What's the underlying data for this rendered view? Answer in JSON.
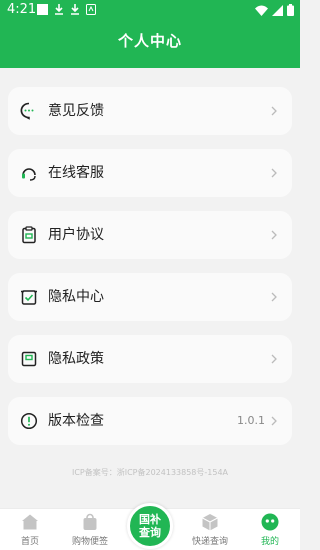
{
  "status_bar": {
    "time": "4:21"
  },
  "header": {
    "title": "个人中心"
  },
  "menu": [
    {
      "label": "意见反馈",
      "icon": "feedback-icon"
    },
    {
      "label": "在线客服",
      "icon": "headset-icon"
    },
    {
      "label": "用户协议",
      "icon": "clipboard-icon"
    },
    {
      "label": "隐私中心",
      "icon": "shield-check-icon"
    },
    {
      "label": "隐私政策",
      "icon": "document-icon"
    },
    {
      "label": "版本检查",
      "icon": "info-icon",
      "value": "1.0.1"
    }
  ],
  "footer": {
    "icp": "ICP备案号：浙ICP备2024133858号-154A"
  },
  "tabbar": {
    "home": "首页",
    "shop": "购物便签",
    "center_line1": "国补",
    "center_line2": "查询",
    "express": "快递查询",
    "mine": "我的"
  },
  "colors": {
    "accent": "#21b654",
    "background": "#f2f2f2",
    "card": "#fafafa"
  }
}
